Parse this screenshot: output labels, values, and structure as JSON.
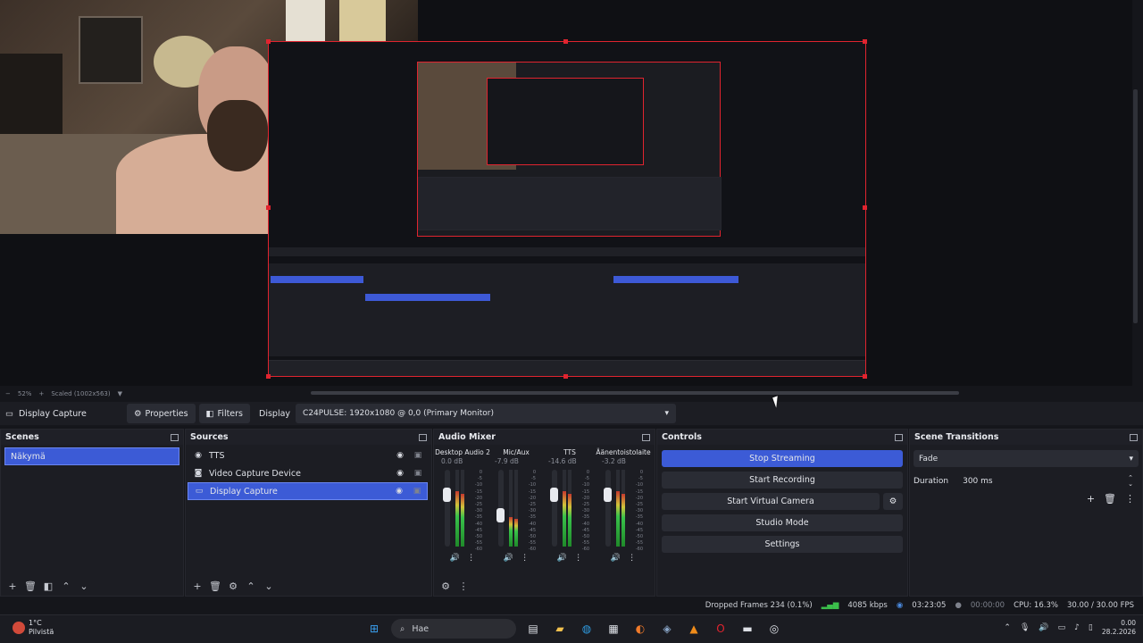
{
  "window": {
    "controls": [
      "—",
      "▢",
      "✕"
    ]
  },
  "preview": {
    "zoom": "52%",
    "scaled": "Scaled (1002x563)"
  },
  "source_toolbar": {
    "source_name": "Display Capture",
    "properties_label": "Properties",
    "filters_label": "Filters",
    "display_label": "Display",
    "display_value": "C24PULSE: 1920x1080 @ 0,0 (Primary Monitor)"
  },
  "scenes": {
    "title": "Scenes",
    "items": [
      "Näkymä"
    ]
  },
  "sources": {
    "title": "Sources",
    "items": [
      {
        "label": "TTS",
        "icon": "speech-icon"
      },
      {
        "label": "Video Capture Device",
        "icon": "camera-icon"
      },
      {
        "label": "Display Capture",
        "icon": "monitor-icon"
      }
    ]
  },
  "audio_mixer": {
    "title": "Audio Mixer",
    "channels": [
      {
        "name": "Desktop Audio 2",
        "db": "0.0 dB",
        "level": 0.72
      },
      {
        "name": "Mic/Aux",
        "db": "-7.9 dB",
        "level": 0.38
      },
      {
        "name": "TTS",
        "db": "-14.6 dB",
        "level": 0.72
      },
      {
        "name": "Äänentoistolaite",
        "db": "-3.2 dB",
        "level": 0.72
      }
    ],
    "meter_ticks": [
      "0",
      "-5",
      "-10",
      "-15",
      "-20",
      "-25",
      "-30",
      "-35",
      "-40",
      "-45",
      "-50",
      "-55",
      "-60"
    ]
  },
  "controls": {
    "title": "Controls",
    "stop_streaming": "Stop Streaming",
    "start_recording": "Start Recording",
    "start_virtual_camera": "Start Virtual Camera",
    "studio_mode": "Studio Mode",
    "settings": "Settings"
  },
  "scene_transitions": {
    "title": "Scene Transitions",
    "transition": "Fade",
    "duration_label": "Duration",
    "duration_value": "300 ms"
  },
  "status_bar": {
    "dropped_frames": "Dropped Frames 234 (0.1%)",
    "bitrate": "4085 kbps",
    "stream_time": "03:23:05",
    "record_time": "00:00:00",
    "cpu": "CPU: 16.3%",
    "fps": "30.00 / 30.00 FPS"
  },
  "taskbar": {
    "weather_temp": "1°C",
    "weather_desc": "Pilvistä",
    "search_placeholder": "Hae",
    "time": "0.00",
    "date": "28.2.2026"
  }
}
